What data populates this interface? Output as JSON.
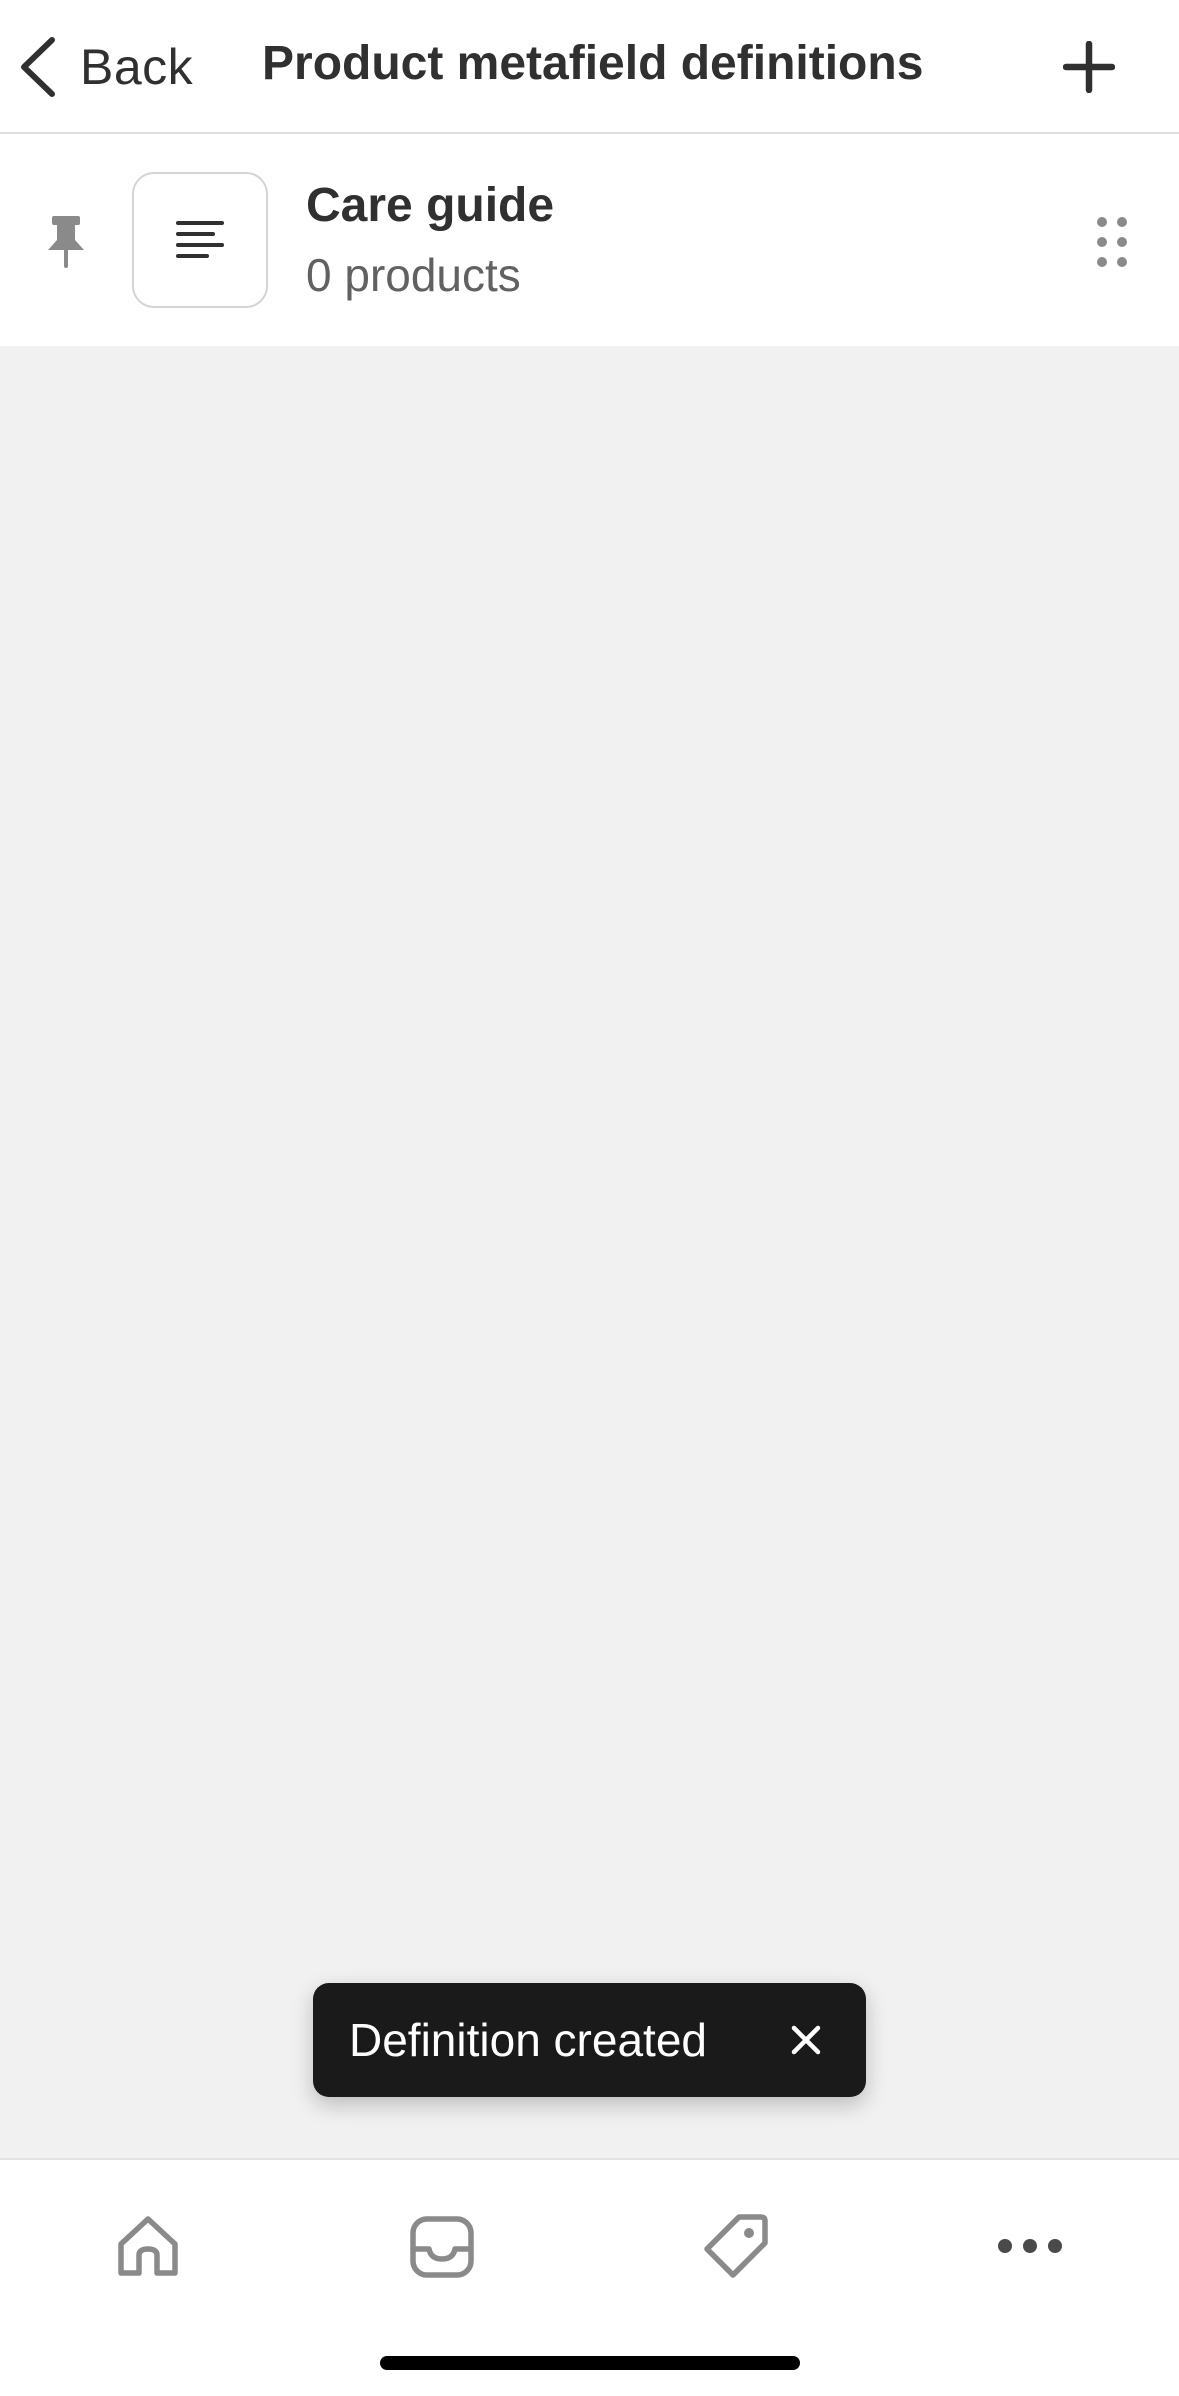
{
  "nav": {
    "back_label": "Back",
    "title": "Product metafield definitions",
    "add_icon": "plus-icon"
  },
  "definitions": [
    {
      "name": "Care guide",
      "count_label": "0 products",
      "pin_icon": "pin-icon",
      "type_icon": "text-lines-icon",
      "handle_icon": "drag-handle-icon"
    }
  ],
  "toast": {
    "message": "Definition created",
    "close_icon": "close-icon"
  },
  "tab_bar": {
    "tabs": [
      {
        "id": "home",
        "icon": "home-icon"
      },
      {
        "id": "inbox",
        "icon": "inbox-icon"
      },
      {
        "id": "products",
        "icon": "tag-icon"
      },
      {
        "id": "more",
        "icon": "more-horizontal-icon"
      }
    ]
  },
  "colors": {
    "background": "#f1f1f1",
    "surface": "#ffffff",
    "text_primary": "#303030",
    "text_secondary": "#616161",
    "toast_background": "#1a1a1a",
    "icon_gray": "#8a8a8a"
  }
}
